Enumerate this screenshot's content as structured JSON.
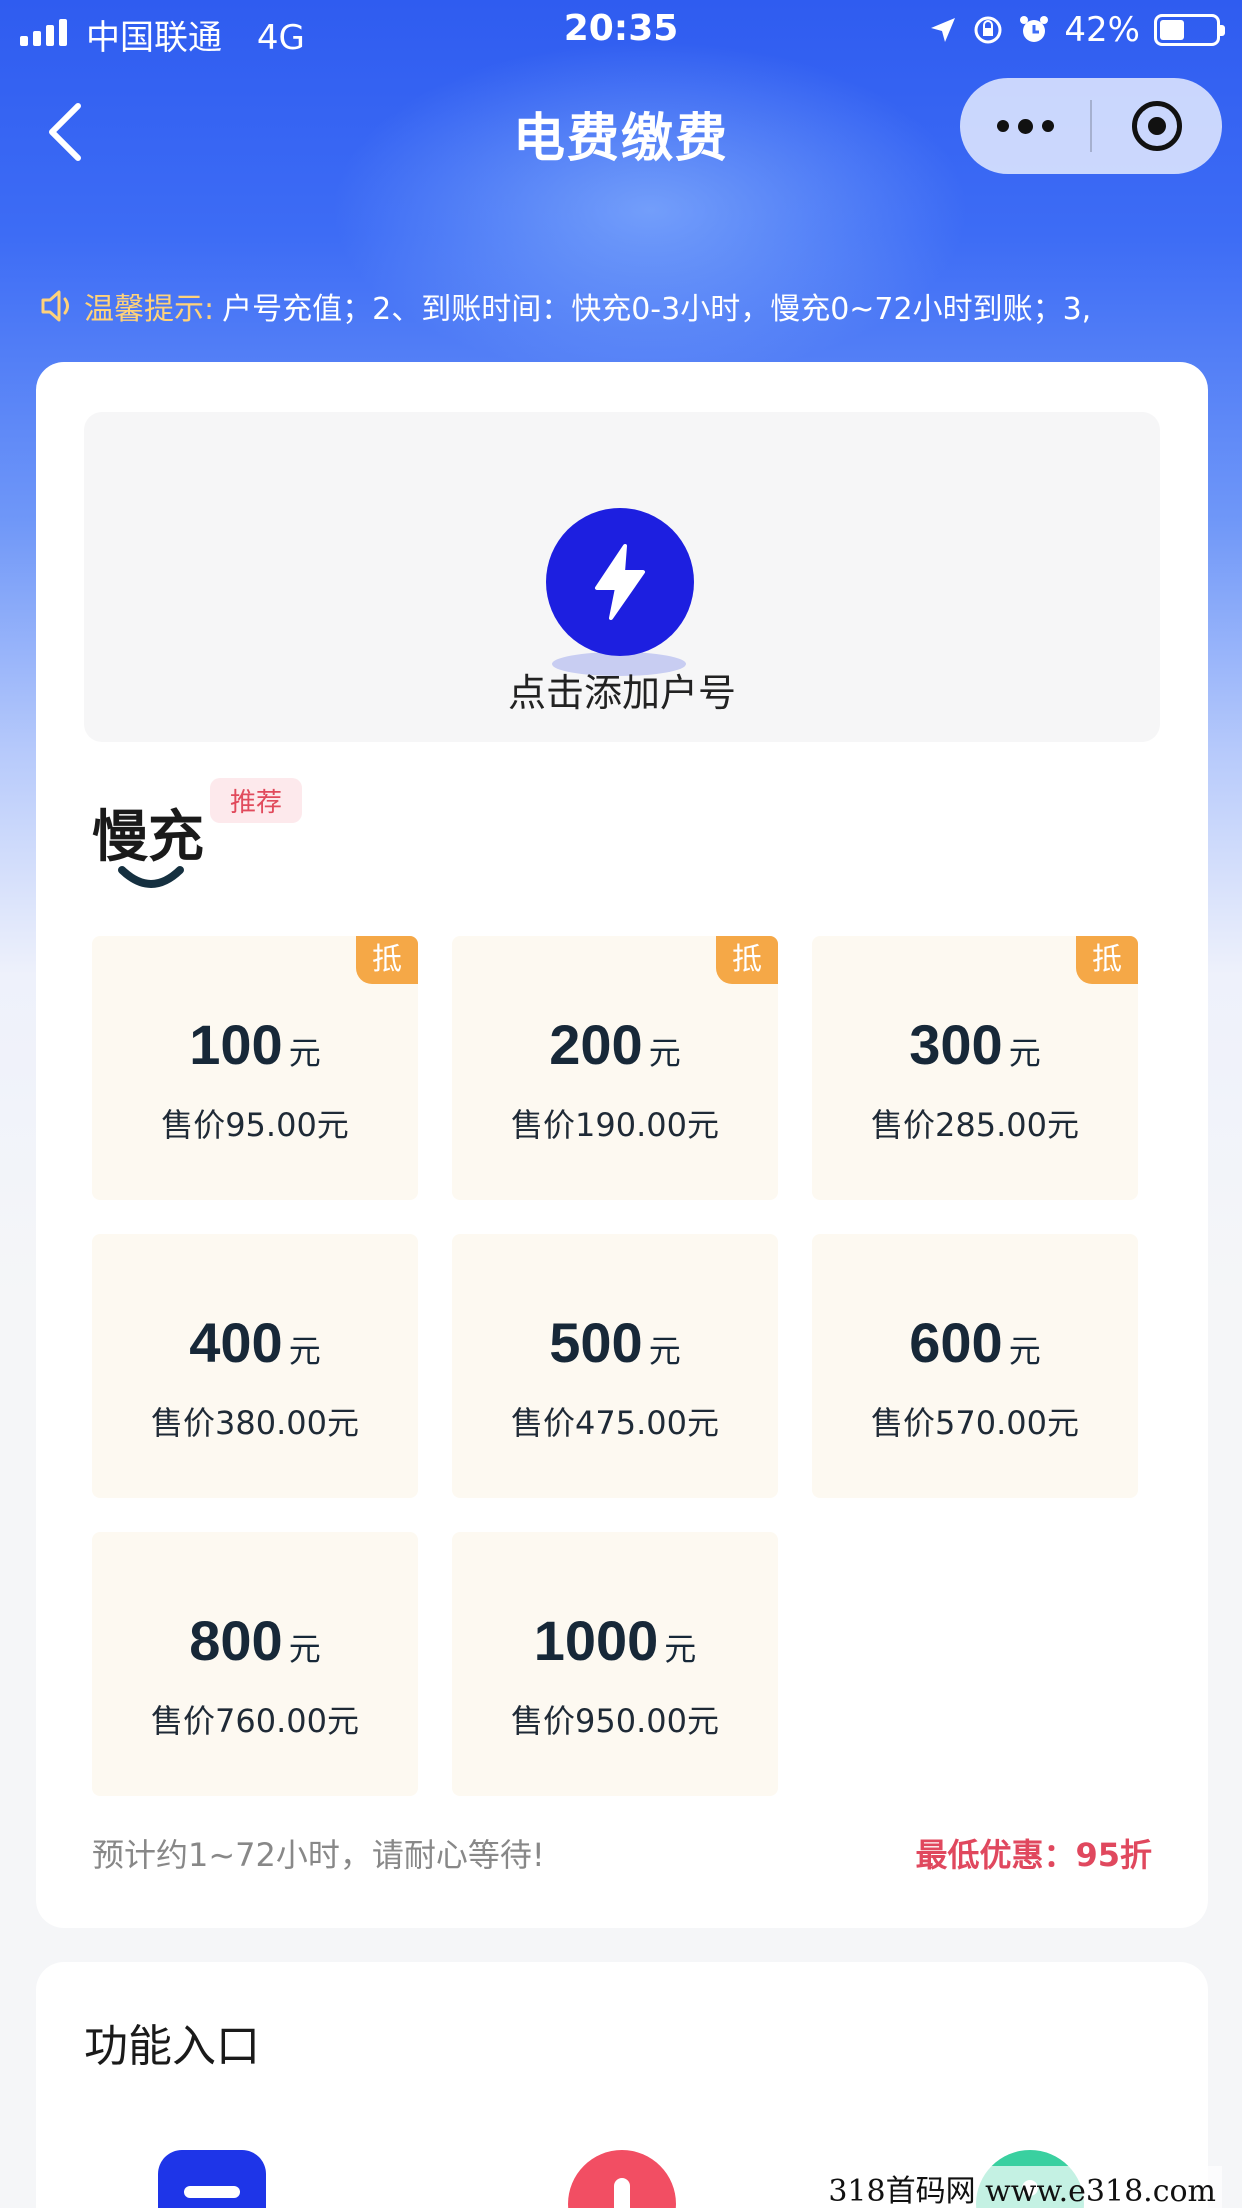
{
  "status_bar": {
    "carrier": "中国联通",
    "network": "4G",
    "time": "20:35",
    "battery": "42%"
  },
  "nav": {
    "title": "电费缴费"
  },
  "notice": {
    "label": "温馨提示:",
    "text": "户号充值；2、到账时间：快充0-3小时，慢充0~72小时到账；3,"
  },
  "account": {
    "add_label": "点击添加户号"
  },
  "section": {
    "title": "慢充",
    "badge": "推荐"
  },
  "denominations": [
    {
      "amount": "100",
      "unit": "元",
      "price": "售价95.00元",
      "tag": "抵"
    },
    {
      "amount": "200",
      "unit": "元",
      "price": "售价190.00元",
      "tag": "抵"
    },
    {
      "amount": "300",
      "unit": "元",
      "price": "售价285.00元",
      "tag": "抵"
    },
    {
      "amount": "400",
      "unit": "元",
      "price": "售价380.00元"
    },
    {
      "amount": "500",
      "unit": "元",
      "price": "售价475.00元"
    },
    {
      "amount": "600",
      "unit": "元",
      "price": "售价570.00元"
    },
    {
      "amount": "800",
      "unit": "元",
      "price": "售价760.00元"
    },
    {
      "amount": "1000",
      "unit": "元",
      "price": "售价950.00元"
    }
  ],
  "footer_info": {
    "eta": "预计约1~72小时，请耐心等待!",
    "discount": "最低优惠：95折"
  },
  "functions": {
    "title": "功能入口",
    "icons": [
      "list-icon",
      "person-icon",
      "info-icon"
    ]
  },
  "watermark": "318首码网 www.e318.com",
  "colors": {
    "primary_blue": "#1d1fe0",
    "tag_orange": "#f5a847",
    "discount_red": "#e0485e",
    "item_bg": "#fdf9f1"
  }
}
